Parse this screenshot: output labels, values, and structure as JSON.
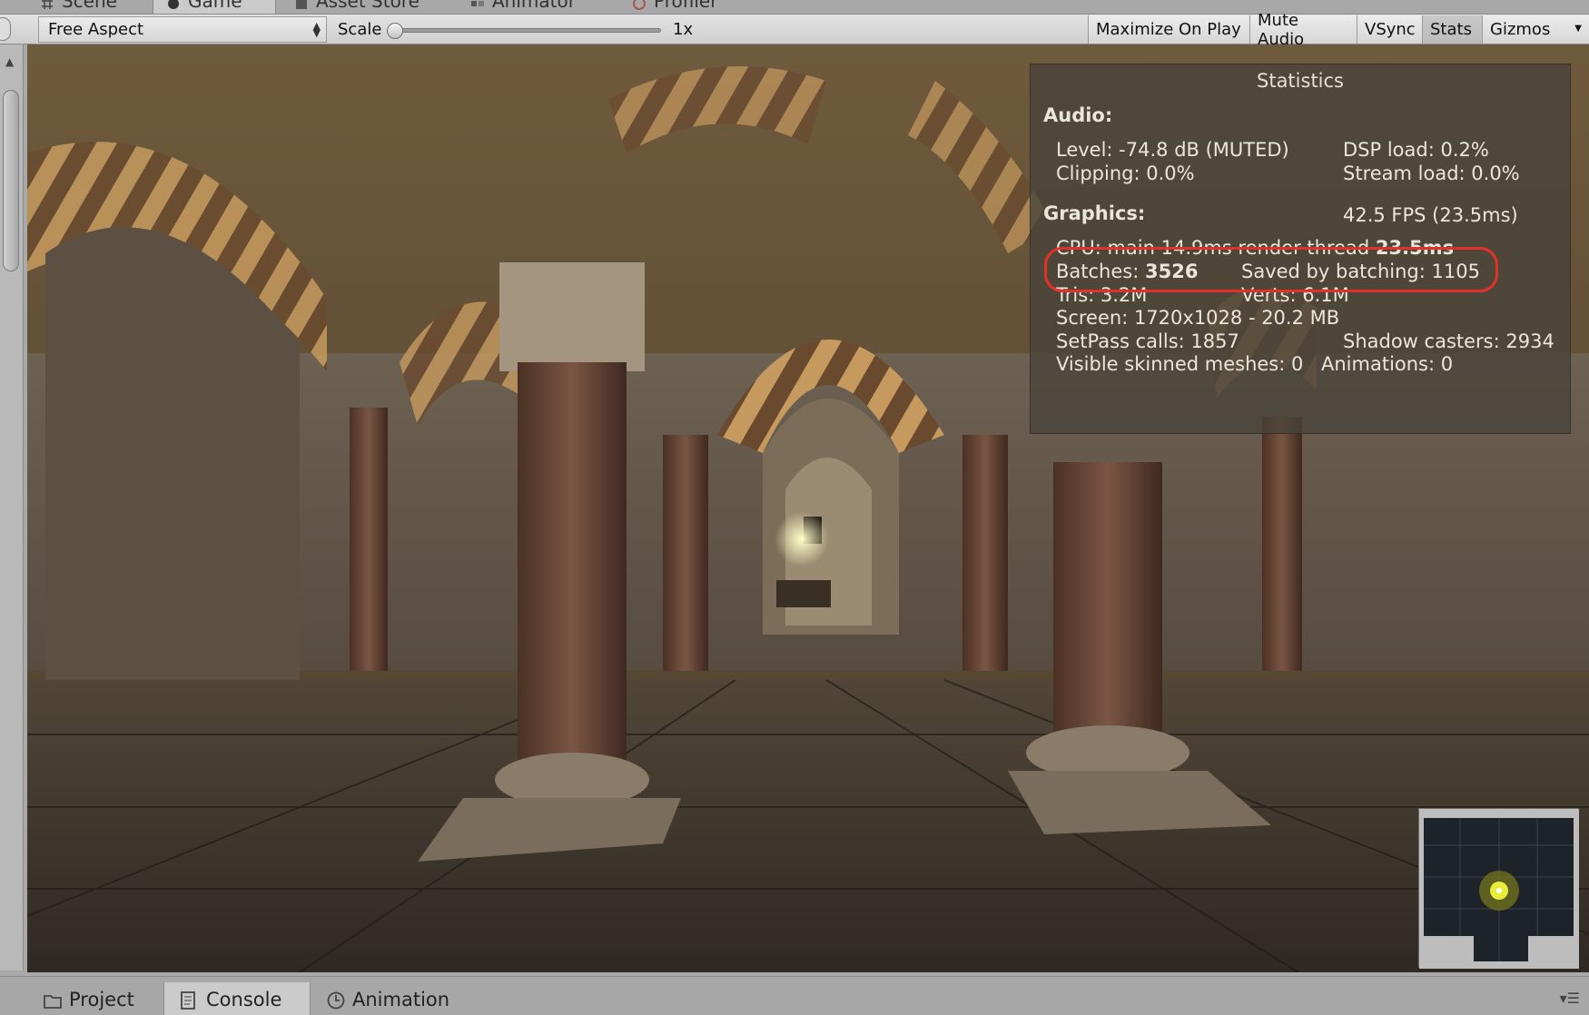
{
  "top_tabs": [
    {
      "label": "Scene",
      "icon": "scene-icon"
    },
    {
      "label": "Game",
      "icon": "game-icon",
      "active": true
    },
    {
      "label": "Asset Store",
      "icon": "asset-store-icon"
    },
    {
      "label": "Animator",
      "icon": "animator-icon"
    },
    {
      "label": "Profiler",
      "icon": "profiler-icon"
    }
  ],
  "toolbar": {
    "aspect": "Free Aspect",
    "scale_label": "Scale",
    "scale_value": "1x",
    "scale_level": 0.0,
    "buttons": {
      "maximize": "Maximize On Play",
      "mute": "Mute Audio",
      "vsync": "VSync",
      "stats": "Stats",
      "gizmos": "Gizmos"
    }
  },
  "stats": {
    "title": "Statistics",
    "audio_header": "Audio:",
    "level": "Level: -74.8 dB (MUTED)",
    "dsp": "DSP load: 0.2%",
    "clipping": "Clipping: 0.0%",
    "stream": "Stream load: 0.0%",
    "graphics_header": "Graphics:",
    "fps": "42.5 FPS (23.5ms)",
    "cpu_prefix": "CPU: main ",
    "cpu_main": "14.9ms",
    "cpu_render_prefix": "  render thread ",
    "cpu_render": "23.5ms",
    "batches_prefix": "Batches: ",
    "batches": "3526",
    "saved": "Saved by batching: 1105",
    "tris": "Tris: 3.2M",
    "verts": "Verts: 6.1M",
    "screen": "Screen: 1720x1028 - 20.2 MB",
    "setpass": "SetPass calls: 1857",
    "shadow": "Shadow casters: 2934",
    "skinned": "Visible skinned meshes: 0",
    "animations": "Animations: 0",
    "highlight_color": "#e2312a"
  },
  "bottom_tabs": [
    {
      "label": "Project",
      "icon": "folder-icon"
    },
    {
      "label": "Console",
      "icon": "console-icon",
      "active": true
    },
    {
      "label": "Animation",
      "icon": "clock-icon"
    }
  ]
}
